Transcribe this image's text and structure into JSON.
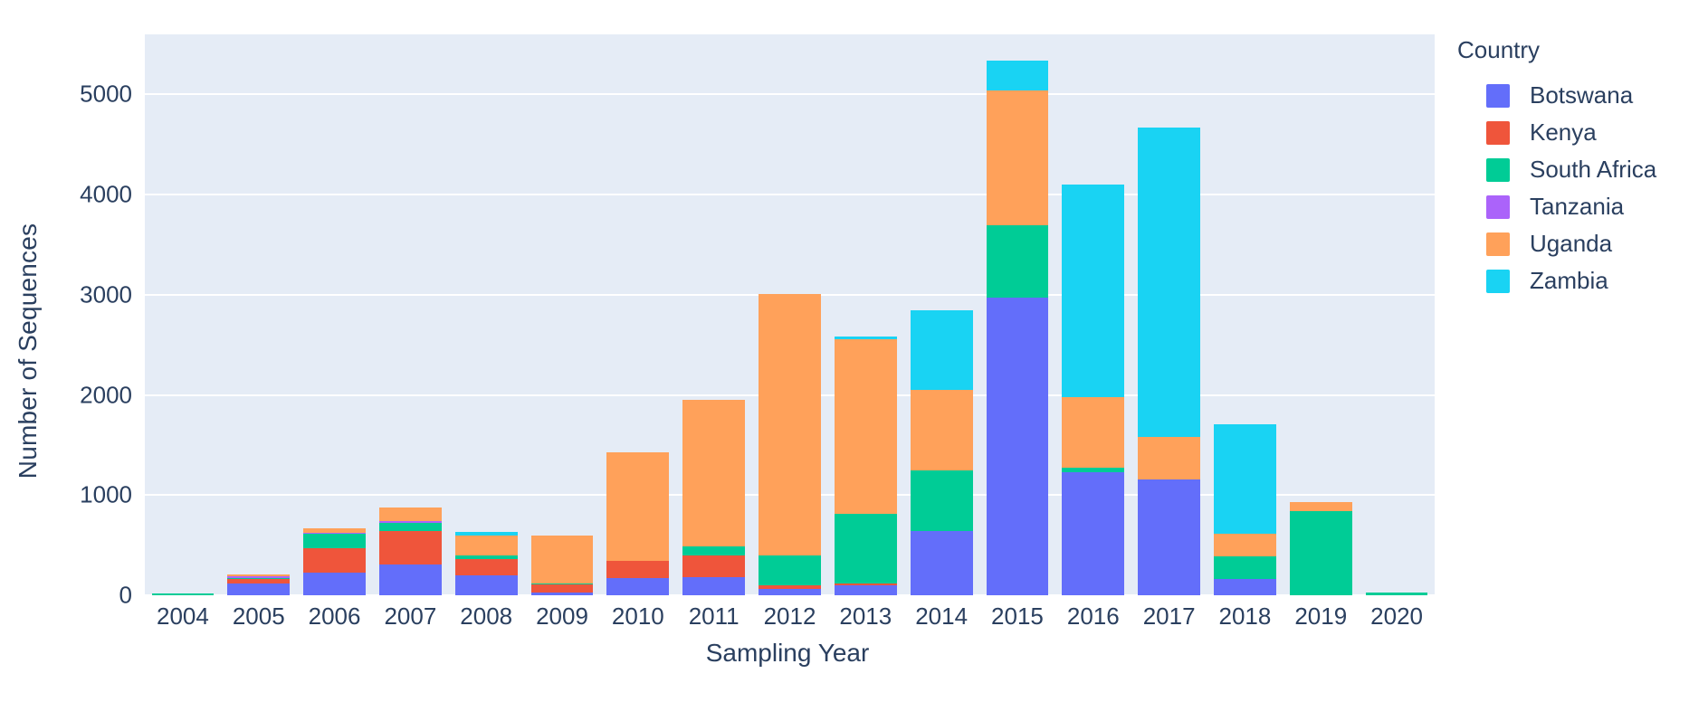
{
  "chart_data": {
    "type": "bar",
    "barmode": "stacked",
    "title": "",
    "xlabel": "Sampling Year",
    "ylabel": "Number of Sequences",
    "categories": [
      "2004",
      "2005",
      "2006",
      "2007",
      "2008",
      "2009",
      "2010",
      "2011",
      "2012",
      "2013",
      "2014",
      "2015",
      "2016",
      "2017",
      "2018",
      "2019",
      "2020"
    ],
    "ytick_labels": [
      "0",
      "1000",
      "2000",
      "3000",
      "4000",
      "5000"
    ],
    "ytick_values": [
      0,
      1000,
      2000,
      3000,
      4000,
      5000
    ],
    "ylim": [
      0,
      5600
    ],
    "grid": true,
    "legend_title": "Country",
    "legend_position": "right",
    "plot_bgcolor": "#e5ecf6",
    "paper_bgcolor": "#ffffff",
    "series": [
      {
        "name": "Botswana",
        "color": "#636efa",
        "values": [
          0,
          115,
          225,
          310,
          200,
          25,
          170,
          180,
          60,
          95,
          640,
          2970,
          1230,
          1160,
          165,
          0,
          0
        ]
      },
      {
        "name": "Kenya",
        "color": "#ef553b",
        "values": [
          0,
          45,
          245,
          330,
          165,
          85,
          170,
          215,
          40,
          25,
          0,
          0,
          0,
          0,
          0,
          0,
          0
        ]
      },
      {
        "name": "South Africa",
        "color": "#00cc96",
        "values": [
          15,
          10,
          140,
          80,
          30,
          10,
          0,
          90,
          300,
          690,
          610,
          720,
          40,
          0,
          220,
          840,
          25
        ]
      },
      {
        "name": "Tanzania",
        "color": "#ab63fa",
        "values": [
          0,
          20,
          15,
          20,
          0,
          0,
          0,
          0,
          0,
          0,
          0,
          0,
          0,
          0,
          0,
          0,
          0
        ]
      },
      {
        "name": "Uganda",
        "color": "#ffa15a",
        "values": [
          0,
          20,
          40,
          140,
          205,
          480,
          1090,
          1470,
          2610,
          1750,
          800,
          1350,
          710,
          420,
          225,
          90,
          0
        ]
      },
      {
        "name": "Zambia",
        "color": "#19d3f3",
        "values": [
          0,
          0,
          0,
          0,
          30,
          0,
          0,
          0,
          0,
          20,
          800,
          300,
          2120,
          3090,
          1100,
          0,
          0
        ]
      }
    ],
    "totals": [
      15,
      210,
      665,
      880,
      630,
      600,
      1430,
      1955,
      3010,
      2580,
      2850,
      5340,
      4100,
      4670,
      1710,
      930,
      25
    ]
  },
  "legend": {
    "title": "Country",
    "items": [
      {
        "label": "Botswana",
        "color": "#636efa"
      },
      {
        "label": "Kenya",
        "color": "#ef553b"
      },
      {
        "label": "South Africa",
        "color": "#00cc96"
      },
      {
        "label": "Tanzania",
        "color": "#ab63fa"
      },
      {
        "label": "Uganda",
        "color": "#ffa15a"
      },
      {
        "label": "Zambia",
        "color": "#19d3f3"
      }
    ]
  },
  "axes": {
    "x_title": "Sampling Year",
    "y_title": "Number of Sequences"
  }
}
